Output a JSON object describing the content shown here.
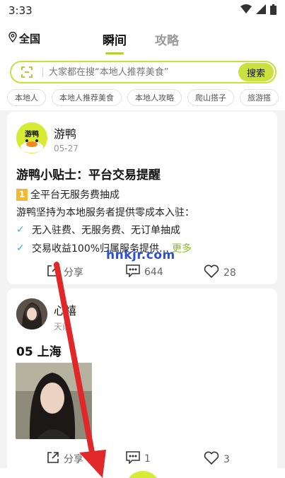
{
  "status_bar": {
    "time": "3:33"
  },
  "header": {
    "location": "全国",
    "tabs": [
      {
        "label": "瞬间",
        "active": true
      },
      {
        "label": "攻略",
        "active": false
      }
    ]
  },
  "search": {
    "placeholder": "大家都在搜“本地人推荐美食”",
    "button_label": "搜索"
  },
  "chips": [
    "本地人",
    "本地人推荐美食",
    "本地人攻略",
    "爬山搭子",
    "旅游搭"
  ],
  "posts": [
    {
      "author": "游鸭",
      "avatar_text": "游鸭",
      "date": "05-27",
      "title": "游鸭小贴士：平台交易提醒",
      "badge": "1",
      "lines": [
        "全平台无服务费抽成",
        "游鸭坚持为本地服务者提供零成本入驻：",
        "无入驻费、无服务费、无订单抽成",
        "交易收益100%归属服务提供…"
      ],
      "more": "更多",
      "share_label": "分享",
      "comments": "644",
      "likes": "28"
    },
    {
      "author": "心禧",
      "date": "天前",
      "title": "05 上海",
      "share_label": "分享",
      "comments": "1",
      "likes": "3"
    }
  ],
  "watermark": "hnkjr.com",
  "colors": {
    "accent": "#c9e03e",
    "more": "#8bbd1f",
    "check": "#47a8e6",
    "arrow": "#e0282a"
  }
}
